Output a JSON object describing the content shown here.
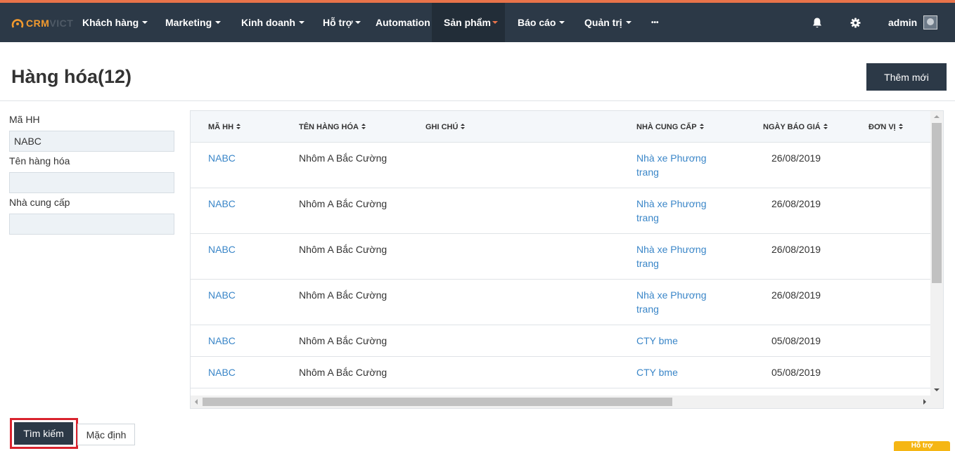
{
  "brand": {
    "logo_main": "CRM",
    "logo_dim": "VICT"
  },
  "nav": {
    "items": [
      {
        "label": "Khách hàng",
        "caret": true
      },
      {
        "label": "Marketing",
        "caret": true
      },
      {
        "label": "Kinh doanh",
        "caret": true
      },
      {
        "label": "Hỗ trợ",
        "caret": true
      },
      {
        "label": "Automation",
        "caret": false
      },
      {
        "label": "Sản phẩm",
        "caret": true,
        "active": true
      },
      {
        "label": "Báo cáo",
        "caret": true
      },
      {
        "label": "Quản trị",
        "caret": true
      },
      {
        "label": "•••",
        "caret": false
      }
    ],
    "user": "admin",
    "icons": [
      "bell-icon",
      "gear-icon"
    ]
  },
  "page": {
    "title": "Hàng hóa(12)",
    "add_button": "Thêm mới"
  },
  "filter": {
    "code_label": "Mã HH",
    "code_value": "NABC",
    "name_label": "Tên hàng hóa",
    "name_value": "",
    "supplier_label": "Nhà cung cấp",
    "supplier_value": "",
    "search_button": "Tìm kiếm",
    "default_button": "Mặc định"
  },
  "table": {
    "columns": [
      "MÃ HH",
      "TÊN HÀNG HÓA",
      "GHI CHÚ",
      "NHÀ CUNG CẤP",
      "NGÀY BÁO GIÁ",
      "ĐƠN VỊ"
    ],
    "rows": [
      {
        "code": "NABC",
        "name": "Nhôm A Bắc Cường",
        "note": "",
        "supplier": "Nhà xe Phương trang",
        "date": "26/08/2019",
        "unit": ""
      },
      {
        "code": "NABC",
        "name": "Nhôm A Bắc Cường",
        "note": "",
        "supplier": "Nhà xe Phương trang",
        "date": "26/08/2019",
        "unit": ""
      },
      {
        "code": "NABC",
        "name": "Nhôm A Bắc Cường",
        "note": "",
        "supplier": "Nhà xe Phương trang",
        "date": "26/08/2019",
        "unit": ""
      },
      {
        "code": "NABC",
        "name": "Nhôm A Bắc Cường",
        "note": "",
        "supplier": "Nhà xe Phương trang",
        "date": "26/08/2019",
        "unit": ""
      },
      {
        "code": "NABC",
        "name": "Nhôm A Bắc Cường",
        "note": "",
        "supplier": "CTY bme",
        "date": "05/08/2019",
        "unit": ""
      },
      {
        "code": "NABC",
        "name": "Nhôm A Bắc Cường",
        "note": "",
        "supplier": "CTY bme",
        "date": "05/08/2019",
        "unit": ""
      }
    ]
  },
  "help_tab": "Hỗ trợ",
  "colors": {
    "nav_bg": "#2c3947",
    "accent": "#e8734a",
    "link": "#3a86c8",
    "highlight": "#d9232e"
  }
}
